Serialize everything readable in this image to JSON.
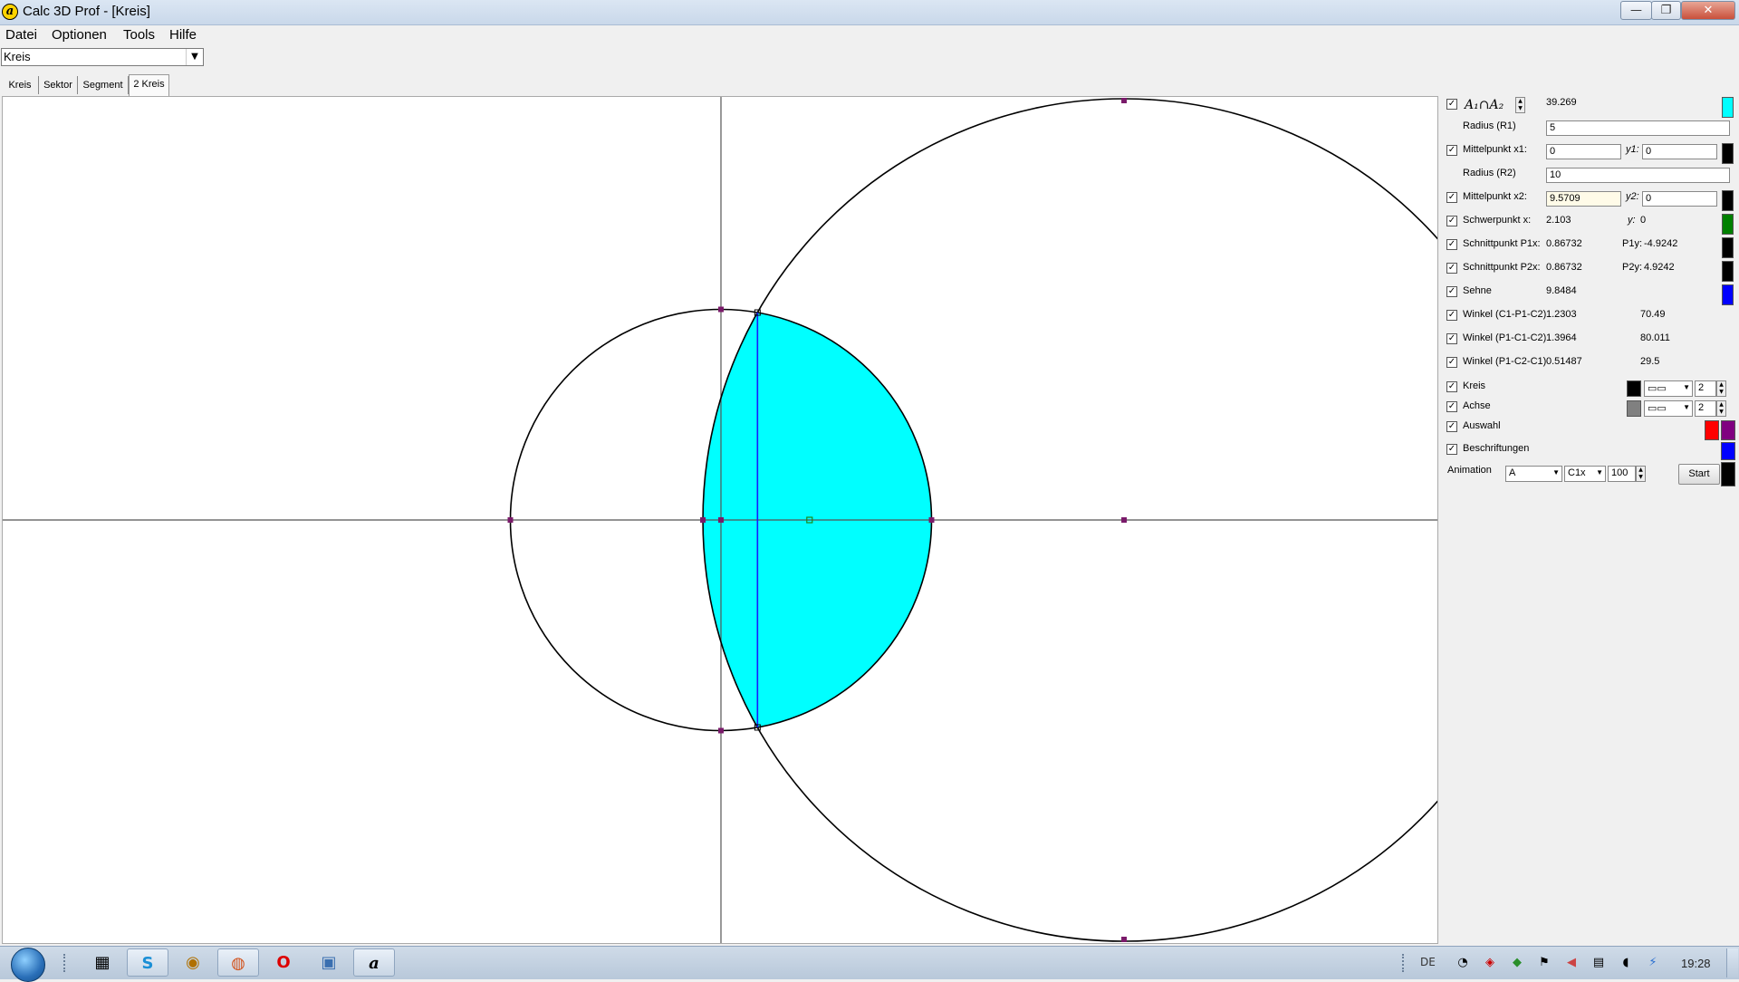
{
  "window": {
    "title": "Calc 3D Prof - [Kreis]",
    "app_icon_glyph": "a",
    "minimize_glyph": "—",
    "maximize_glyph": "❐",
    "close_glyph": "✕"
  },
  "menu": [
    "Datei",
    "Optionen",
    "Tools",
    "Hilfe"
  ],
  "shape_select": {
    "value": "Kreis"
  },
  "tabs": [
    "Kreis",
    "Sektor",
    "Segment",
    "2 Kreis"
  ],
  "active_tab": "2 Kreis",
  "panel": {
    "intersection_label": "A₁∩A₂",
    "intersection_area": "39.269",
    "radius1_label": "Radius (R1)",
    "radius1": "5",
    "center1_label": "Mittelpunkt x1:",
    "center1_x": "0",
    "y1_label": "y1:",
    "center1_y": "0",
    "radius2_label": "Radius (R2)",
    "radius2": "10",
    "center2_label": "Mittelpunkt x2:",
    "center2_x": "9.5709",
    "y2_label": "y2:",
    "center2_y": "0",
    "centroid_label": "Schwerpunkt x:",
    "centroid_x": "2.103",
    "centroid_y_label": "y:",
    "centroid_y": "0",
    "p1_label": "Schnittpunkt P1x:",
    "p1_x": "0.86732",
    "p1y_label": "P1y:",
    "p1_y": "-4.9242",
    "p2_label": "Schnittpunkt P2x:",
    "p2_x": "0.86732",
    "p2y_label": "P2y:",
    "p2_y": "4.9242",
    "chord_label": "Sehne",
    "chord": "9.8484",
    "angle1_label": "Winkel (C1-P1-C2)",
    "angle1_rad": "1.2303",
    "angle1_deg": "70.49",
    "angle2_label": "Winkel (P1-C1-C2)",
    "angle2_rad": "1.3964",
    "angle2_deg": "80.011",
    "angle3_label": "Winkel (P1-C2-C1)",
    "angle3_rad": "0.51487",
    "angle3_deg": "29.5",
    "circle_label": "Kreis",
    "circle_width": "2",
    "axis_label": "Achse",
    "axis_width": "2",
    "selection_label": "Auswahl",
    "labels_label": "Beschriftungen",
    "animation_label": "Animation",
    "animation_var": "A",
    "animation_param": "C1x",
    "animation_steps": "100",
    "start_label": "Start",
    "check_glyph": "✓"
  },
  "colors": {
    "intersection_fill": "#00ffff",
    "circle_stroke": "#000000",
    "axis_stroke": "#555555",
    "chord": "#1a1aff",
    "point_marker": "#7a1a6a",
    "centroid_marker": "#1a8a1a",
    "swatch_area": "#00ffff",
    "swatch_c1": "#000000",
    "swatch_c2": "#000000",
    "swatch_centroid": "#008000",
    "swatch_p1": "#000000",
    "swatch_p2": "#000000",
    "swatch_chord": "#0000ff",
    "swatch_circle": "#000000",
    "swatch_axis": "#808080",
    "swatch_sel1": "#ff0000",
    "swatch_sel2": "#800080",
    "swatch_labels": "#0000ff",
    "swatch_bottom": "#000000"
  },
  "geometry_data": {
    "circle1": {
      "cx": 0,
      "cy": 0,
      "r": 5
    },
    "circle2": {
      "cx": 9.5709,
      "cy": 0,
      "r": 10
    },
    "intersection_points": [
      [
        0.86732,
        -4.9242
      ],
      [
        0.86732,
        4.9242
      ]
    ],
    "centroid": [
      2.103,
      0
    ]
  },
  "taskbar": {
    "apps": [
      "explorer-icon",
      "skype-icon",
      "app-icon",
      "firefox-icon",
      "opera-icon",
      "network-icon",
      "calc3d-icon"
    ],
    "app_glyphs": [
      "▦",
      "S",
      "◉",
      "◍",
      "O",
      "▣",
      "a"
    ],
    "language": "DE",
    "clock": "19:28"
  }
}
